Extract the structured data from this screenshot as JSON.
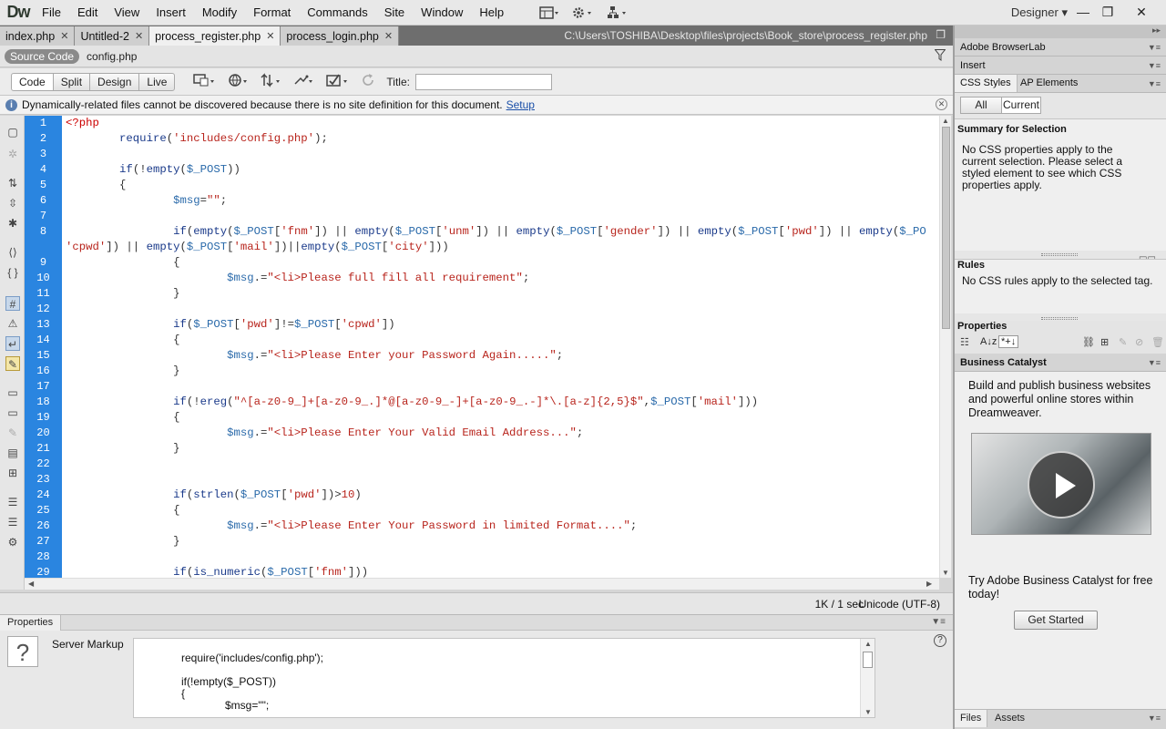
{
  "app": {
    "logo": "Dw",
    "workspace": "Designer",
    "workspace_caret": "▾"
  },
  "menu": [
    "File",
    "Edit",
    "View",
    "Insert",
    "Modify",
    "Format",
    "Commands",
    "Site",
    "Window",
    "Help"
  ],
  "toolbar_icons": [
    "layout-icon",
    "gear-icon",
    "sitemap-icon"
  ],
  "window_controls": {
    "minimize": "—",
    "restore": "❐",
    "close": "✕"
  },
  "doc_tabs": [
    {
      "label": "index.php",
      "active": false
    },
    {
      "label": "Untitled-2",
      "active": false
    },
    {
      "label": "process_register.php",
      "active": true
    },
    {
      "label": "process_login.php",
      "active": false
    }
  ],
  "file_path": "C:\\Users\\TOSHIBA\\Desktop\\files\\projects\\Book_store\\process_register.php",
  "related_files": {
    "source": "Source Code",
    "config": "config.php"
  },
  "doc_toolbar": {
    "views": [
      "Code",
      "Split",
      "Design",
      "Live"
    ],
    "active_view": "Code",
    "title_label": "Title:",
    "title_value": ""
  },
  "info_bar": {
    "text": "Dynamically-related files cannot be discovered because there is no site definition for this document.",
    "link": "Setup"
  },
  "code_lines": [
    {
      "n": "1",
      "html": "<span class='tag'>&lt;?php</span>"
    },
    {
      "n": "2",
      "html": "         <span class='fn'>require</span>(<span class='str'>'includes/config.php'</span>);"
    },
    {
      "n": "3",
      "html": ""
    },
    {
      "n": "4",
      "html": "         <span class='fn'>if</span>(!<span class='fn'>empty</span>(<span class='var'>$_POST</span>))"
    },
    {
      "n": "5",
      "html": "         {"
    },
    {
      "n": "6",
      "html": "                 <span class='var'>$msg</span>=<span class='str'>\"\"</span>;"
    },
    {
      "n": "7",
      "html": ""
    },
    {
      "n": "8",
      "html": "                 <span class='fn'>if</span>(<span class='fn'>empty</span>(<span class='var'>$_POST</span>[<span class='str'>'fnm'</span>]) || <span class='fn'>empty</span>(<span class='var'>$_POST</span>[<span class='str'>'unm'</span>]) || <span class='fn'>empty</span>(<span class='var'>$_POST</span>[<span class='str'>'gender'</span>]) || <span class='fn'>empty</span>(<span class='var'>$_POST</span>[<span class='str'>'pwd'</span>]) || <span class='fn'>empty</span>(<span class='var'>$_PO</span>"
    },
    {
      "n": "",
      "html": "<span class='str'>'cpwd'</span>]) || <span class='fn'>empty</span>(<span class='var'>$_POST</span>[<span class='str'>'mail'</span>])||<span class='fn'>empty</span>(<span class='var'>$_POST</span>[<span class='str'>'city'</span>]))"
    },
    {
      "n": "9",
      "html": "                 {"
    },
    {
      "n": "10",
      "html": "                         <span class='var'>$msg</span>.=<span class='str'>\"&lt;li&gt;Please full fill all requirement\"</span>;"
    },
    {
      "n": "11",
      "html": "                 }"
    },
    {
      "n": "12",
      "html": ""
    },
    {
      "n": "13",
      "html": "                 <span class='fn'>if</span>(<span class='var'>$_POST</span>[<span class='str'>'pwd'</span>]!=<span class='var'>$_POST</span>[<span class='str'>'cpwd'</span>])"
    },
    {
      "n": "14",
      "html": "                 {"
    },
    {
      "n": "15",
      "html": "                         <span class='var'>$msg</span>.=<span class='str'>\"&lt;li&gt;Please Enter your Password Again.....\"</span>;"
    },
    {
      "n": "16",
      "html": "                 }"
    },
    {
      "n": "17",
      "html": ""
    },
    {
      "n": "18",
      "html": "                 <span class='fn'>if</span>(!<span class='fn'>ereg</span>(<span class='str'>\"^[a-z0-9_]+[a-z0-9_.]*@[a-z0-9_-]+[a-z0-9_.-]*\\.[a-z]{2,5}$\"</span>,<span class='var'>$_POST</span>[<span class='str'>'mail'</span>]))"
    },
    {
      "n": "19",
      "html": "                 {"
    },
    {
      "n": "20",
      "html": "                         <span class='var'>$msg</span>.=<span class='str'>\"&lt;li&gt;Please Enter Your Valid Email Address...\"</span>;"
    },
    {
      "n": "21",
      "html": "                 }"
    },
    {
      "n": "22",
      "html": ""
    },
    {
      "n": "23",
      "html": ""
    },
    {
      "n": "24",
      "html": "                 <span class='fn'>if</span>(<span class='fn'>strlen</span>(<span class='var'>$_POST</span>[<span class='str'>'pwd'</span>])&gt;<span class='str'>10</span>)"
    },
    {
      "n": "25",
      "html": "                 {"
    },
    {
      "n": "26",
      "html": "                         <span class='var'>$msg</span>.=<span class='str'>\"&lt;li&gt;Please Enter Your Password in limited Format....\"</span>;"
    },
    {
      "n": "27",
      "html": "                 }"
    },
    {
      "n": "28",
      "html": ""
    },
    {
      "n": "29",
      "html": "                 <span class='fn'>if</span>(<span class='fn'>is_numeric</span>(<span class='var'>$_POST</span>[<span class='str'>'fnm'</span>]))"
    }
  ],
  "status": {
    "size": "1K / 1 sec",
    "encoding": "Unicode (UTF-8)"
  },
  "properties": {
    "tab": "Properties",
    "label": "Server Markup",
    "markup_lines": [
      "require('includes/config.php');",
      "if(!empty($_POST))",
      "{",
      "$msg=\"\";"
    ]
  },
  "right": {
    "browserlab": "Adobe BrowserLab",
    "insert": "Insert",
    "tabs": [
      "CSS Styles",
      "AP Elements"
    ],
    "subtabs": [
      "All",
      "Current"
    ],
    "summary_title": "Summary for Selection",
    "summary_text": "No CSS properties apply to the current selection.  Please select a styled element to see which CSS properties apply.",
    "rules_title": "Rules",
    "rules_text": "No CSS rules apply to the selected tag.",
    "props_title": "Properties",
    "bc_header": "Business Catalyst",
    "bc_text": "Build and publish business websites and powerful online stores within Dreamweaver.",
    "bc_try": "Try Adobe Business Catalyst for free today!",
    "bc_button": "Get Started",
    "bottom_tabs": [
      "Files",
      "Assets"
    ]
  }
}
